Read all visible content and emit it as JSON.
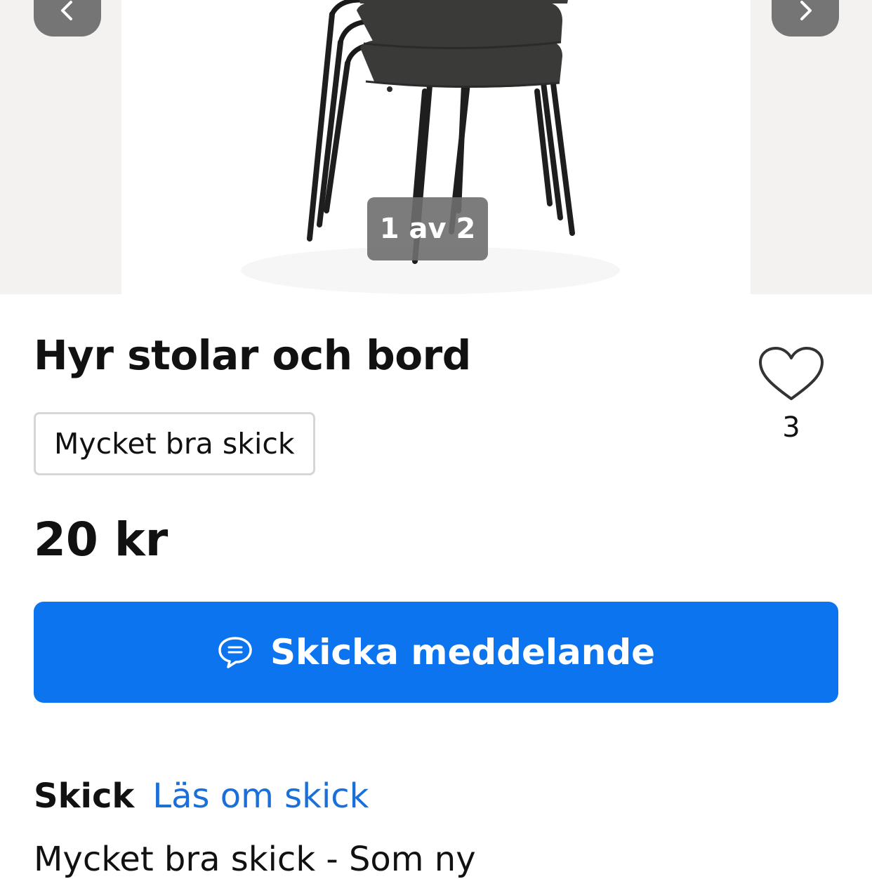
{
  "gallery": {
    "counter": "1 av 2",
    "prev_icon": "chevron-left-icon",
    "next_icon": "chevron-right-icon"
  },
  "listing": {
    "title": "Hyr stolar och bord",
    "condition_badge": "Mycket bra skick",
    "price": "20 kr",
    "favorite_icon": "heart-outline-icon",
    "favorite_count": "3"
  },
  "actions": {
    "message_label": "Skicka meddelande",
    "message_icon": "chat-bubble-icon"
  },
  "condition_section": {
    "heading": "Skick",
    "link_label": "Läs om skick",
    "description": "Mycket bra skick - Som ny"
  },
  "colors": {
    "primary": "#0b74ee",
    "link": "#1b6fd8",
    "nav_button": "#757575",
    "gallery_bg": "#f3f2f0"
  }
}
